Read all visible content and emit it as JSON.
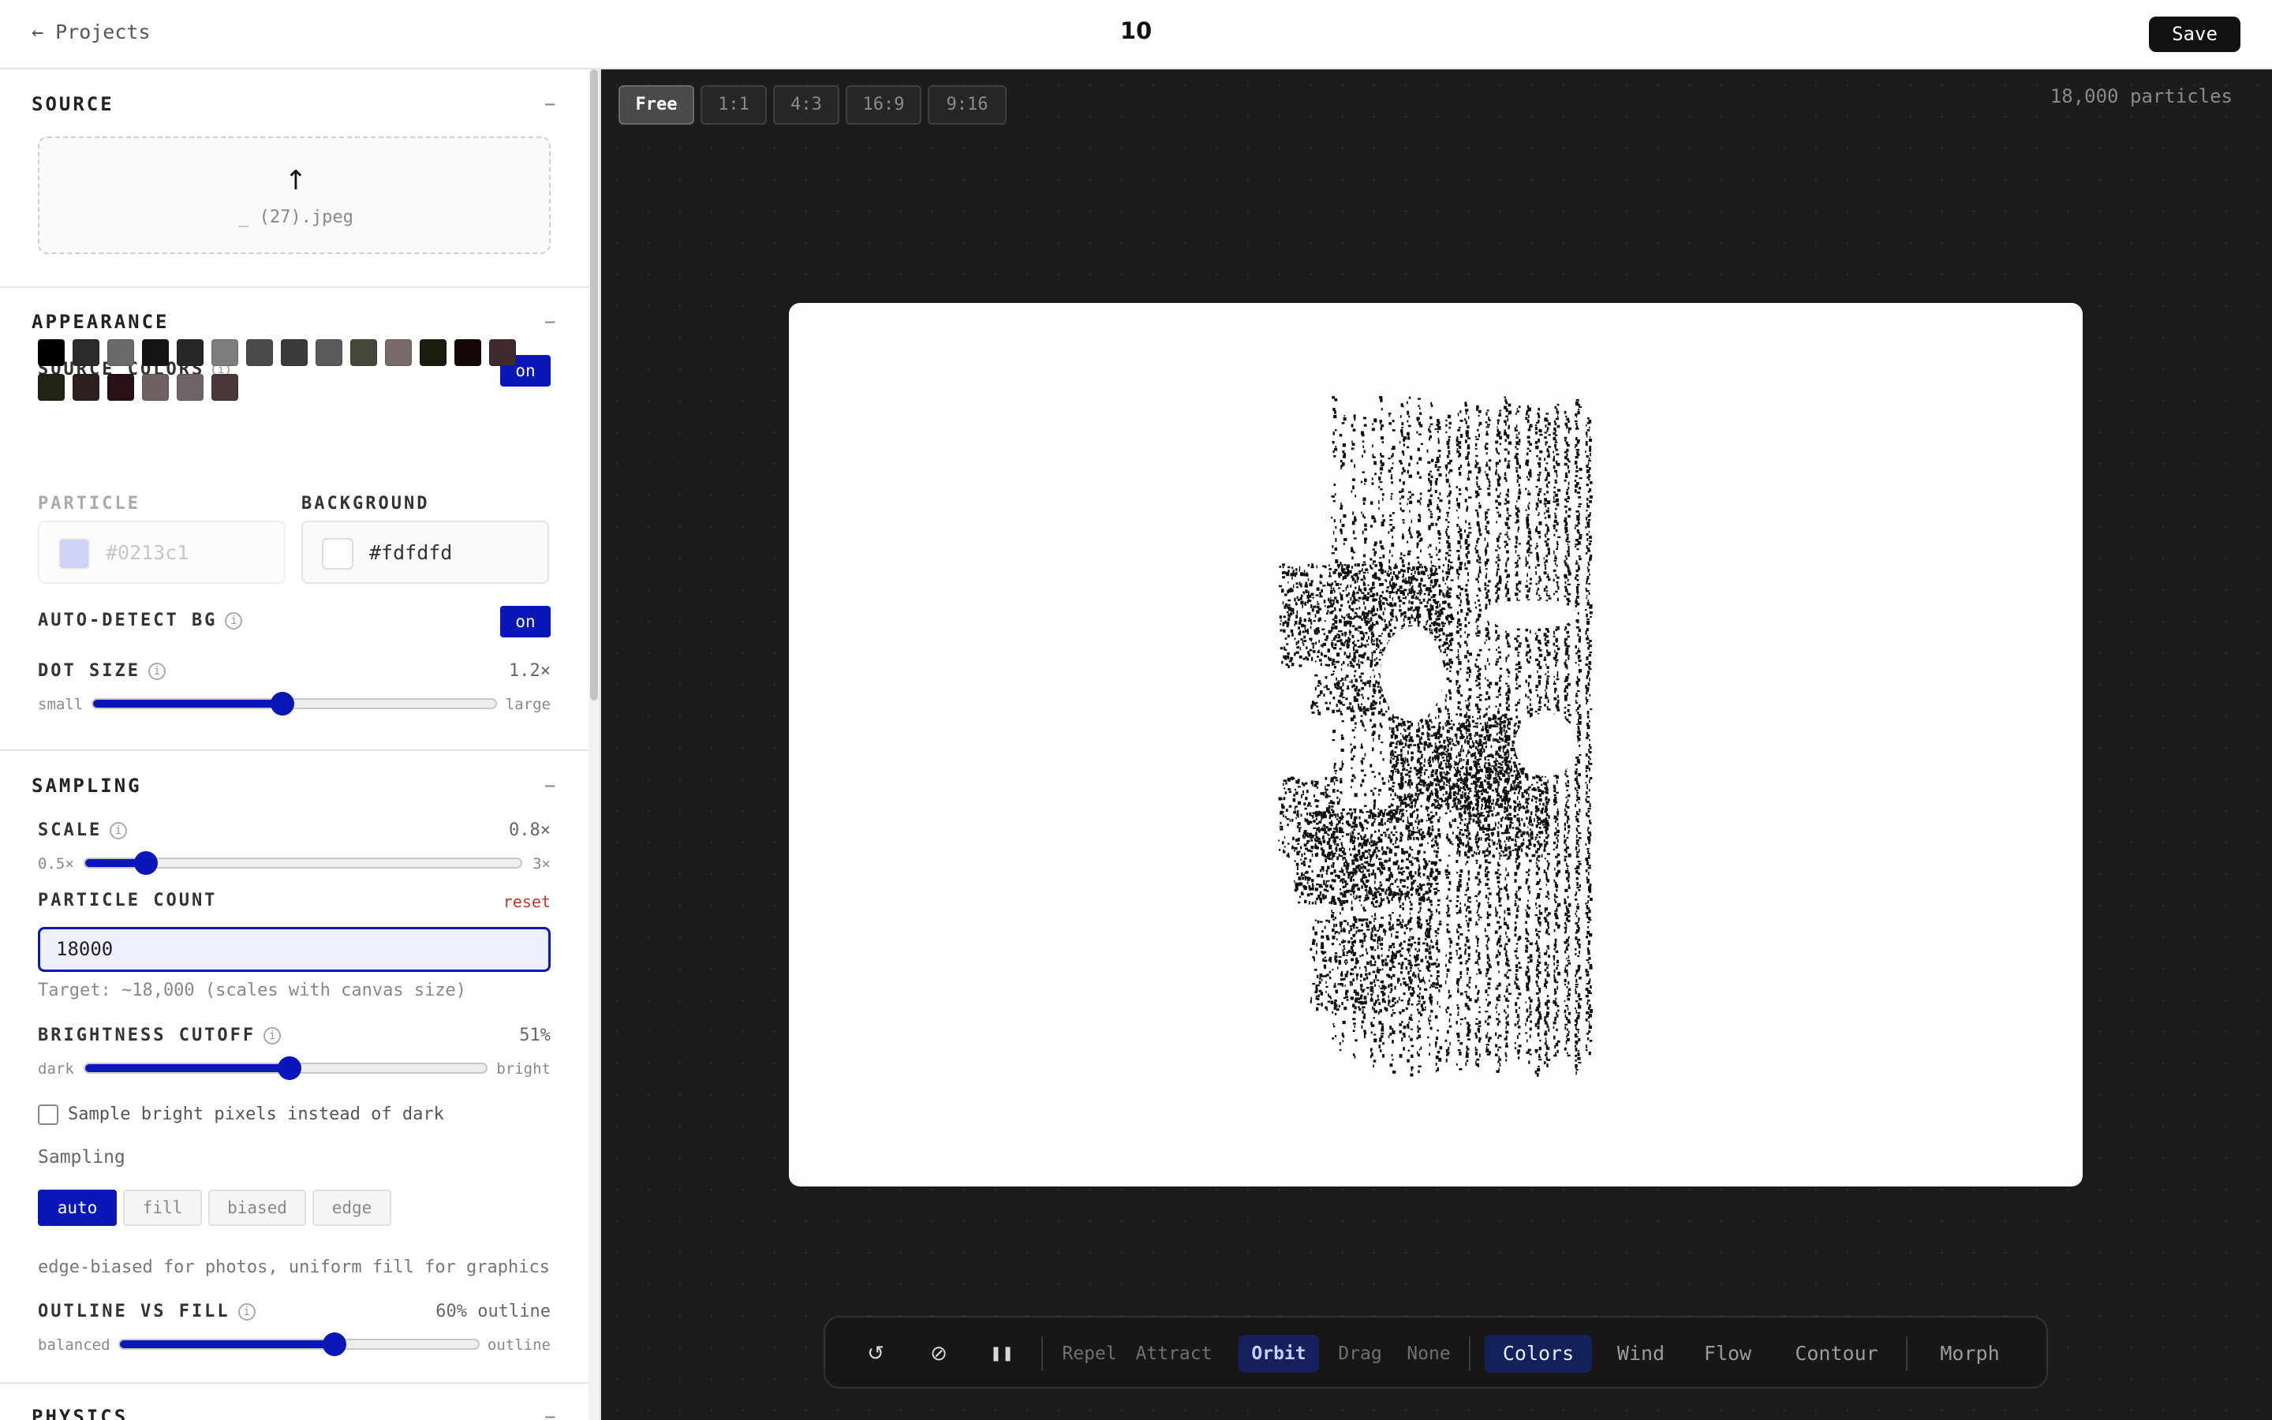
{
  "topbar": {
    "back_label": "← Projects",
    "title": "10",
    "save_label": "Save"
  },
  "source": {
    "heading": "SOURCE",
    "toggle": "−",
    "upload_icon": "upload-arrow-icon",
    "upload_glyph": "↑",
    "file_name": "_ (27).jpeg"
  },
  "appearance": {
    "heading": "APPEARANCE",
    "toggle": "−",
    "source_colors_label": "SOURCE COLORS",
    "source_colors_state": "on",
    "swatches": [
      "#000000",
      "#2b2b2b",
      "#6a6a6a",
      "#141414",
      "#262626",
      "#7d7d7d",
      "#4a4a4a",
      "#3b3b3b",
      "#5a5a5a",
      "#44483a",
      "#7a6a6a",
      "#1b1c10",
      "#160707",
      "#3f2b2b",
      "#1f2413",
      "#2e1f1f",
      "#291015",
      "#6e6161",
      "#6f6466",
      "#4a3838"
    ],
    "particle_label": "PARTICLE",
    "particle_color": "#0213c1",
    "particle_chip": "#a8aef0",
    "background_label": "BACKGROUND",
    "background_color": "#fdfdfd",
    "auto_detect_label": "AUTO-DETECT BG",
    "auto_detect_state": "on",
    "dot_size_label": "DOT SIZE",
    "dot_size_value": "1.2×",
    "dot_size_fraction": 0.47,
    "dot_size_min": "small",
    "dot_size_max": "large"
  },
  "sampling": {
    "heading": "SAMPLING",
    "toggle": "−",
    "scale_label": "SCALE",
    "scale_value": "0.8×",
    "scale_fraction": 0.14,
    "scale_min": "0.5×",
    "scale_max": "3×",
    "count_label": "PARTICLE COUNT",
    "count_reset": "reset",
    "count_value": "18000",
    "count_hint": "Target: ~18,000 (scales with canvas size)",
    "brightness_label": "BRIGHTNESS CUTOFF",
    "brightness_value": "51%",
    "brightness_fraction": 0.51,
    "brightness_min": "dark",
    "brightness_max": "bright",
    "invert_label": "Sample bright pixels instead of dark",
    "mode_label": "Sampling",
    "modes": [
      "auto",
      "fill",
      "biased",
      "edge"
    ],
    "mode_hint": "edge-biased for photos, uniform fill for graphics",
    "outline_label": "OUTLINE VS FILL",
    "outline_value": "60% outline",
    "outline_fraction": 0.6,
    "outline_min": "balanced",
    "outline_max": "outline"
  },
  "physics": {
    "heading": "PHYSICS",
    "toggle": "−"
  },
  "stage": {
    "ratios": [
      "Free",
      "1:1",
      "4:3",
      "16:9",
      "9:16"
    ],
    "particle_count": "18,000 particles"
  },
  "toolbar": {
    "reset_glyph": "↺",
    "clear_glyph": "⊘",
    "pause_glyph": "❚❚",
    "modes": [
      "Repel",
      "Attract",
      "Orbit",
      "Drag",
      "None"
    ],
    "effects": [
      "Colors",
      "Wind",
      "Flow",
      "Contour"
    ],
    "morph": "Morph"
  }
}
